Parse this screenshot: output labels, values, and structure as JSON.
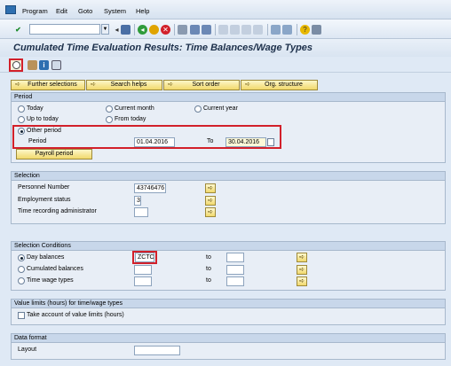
{
  "menu": [
    "Program",
    "Edit",
    "Goto",
    "System",
    "Help"
  ],
  "title": "Cumulated Time Evaluation Results: Time Balances/Wage Types",
  "tabs": [
    "Further selections",
    "Search helps",
    "Sort order",
    "Org. structure"
  ],
  "period": {
    "header": "Period",
    "options": [
      "Today",
      "Current month",
      "Current year",
      "Up to today",
      "From today",
      "Other period"
    ],
    "selected": "Other period",
    "period_label": "Period",
    "from": "01.04.2016",
    "to_label": "To",
    "to": "30.04.2016",
    "payroll_button": "Payroll period"
  },
  "selection": {
    "header": "Selection",
    "personnel_number_label": "Personnel Number",
    "personnel_number": "43746476",
    "employment_status_label": "Employment status",
    "employment_status": "3",
    "time_admin_label": "Time recording administrator",
    "time_admin": ""
  },
  "conditions": {
    "header": "Selection Conditions",
    "day_balances": "Day balances",
    "day_balances_value": "ZCTO",
    "cumulated_balances": "Cumulated balances",
    "time_wage_types": "Time wage types",
    "to_label": "to",
    "selected": "Day balances"
  },
  "value_limits": {
    "header": "Value limits (hours) for time/wage types",
    "checkbox_label": "Take account of value limits (hours)",
    "checked": false
  },
  "data_format": {
    "header": "Data format",
    "layout_label": "Layout",
    "layout_value": ""
  },
  "icons": {
    "enter": "check-icon",
    "save": "save-icon",
    "back": "back-icon",
    "exit": "exit-icon",
    "cancel": "cancel-icon",
    "print": "print-icon",
    "find": "find-icon",
    "execute": "execute-icon",
    "info": "info-icon",
    "help": "help-icon"
  },
  "colors": {
    "highlight": "#d2202a",
    "button": "#f1d96c"
  }
}
